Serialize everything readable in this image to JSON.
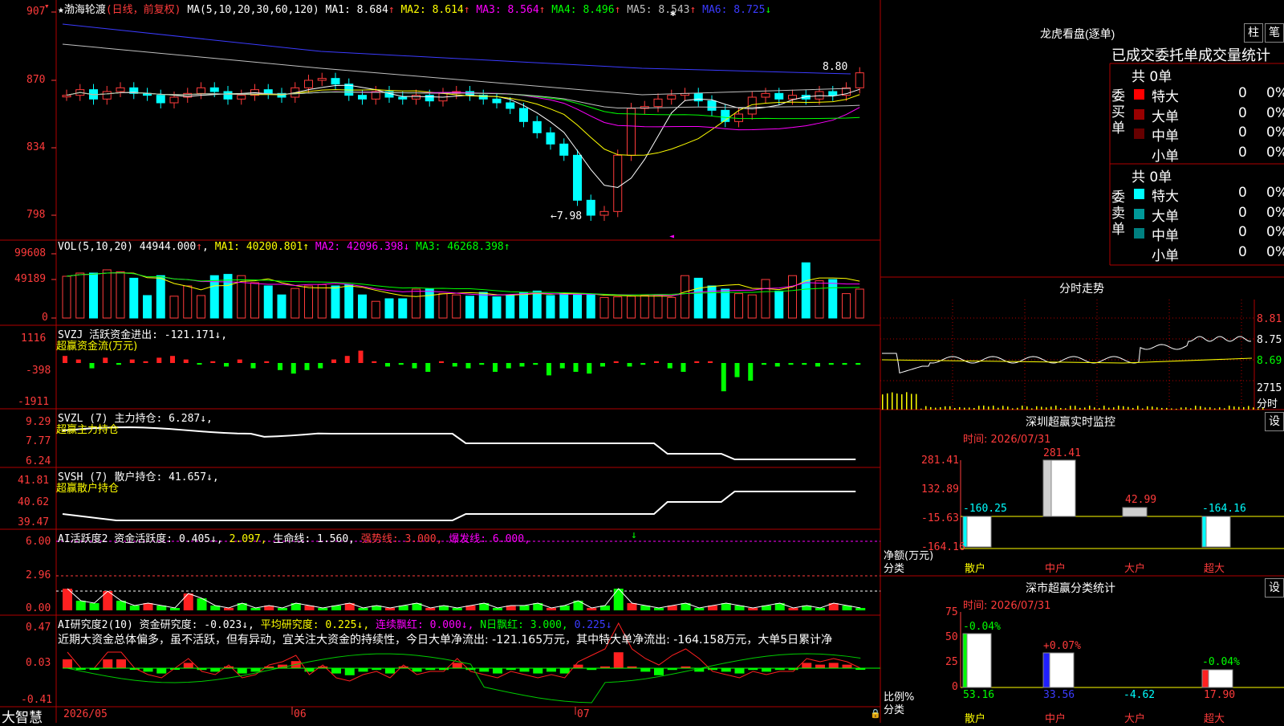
{
  "main": {
    "star": "★",
    "stock_name": "渤海轮渡",
    "mode": "(日线，前复权)",
    "ma_title": "MA(5,10,20,30,60,120)",
    "ma": [
      {
        "label": "MA1:",
        "value": "8.684",
        "arrow": "↑",
        "color": "#ffffff"
      },
      {
        "label": "MA2:",
        "value": "8.614",
        "arrow": "↑",
        "color": "#ffff00"
      },
      {
        "label": "MA3:",
        "value": "8.564",
        "arrow": "↑",
        "color": "#ff00ff"
      },
      {
        "label": "MA4:",
        "value": "8.496",
        "arrow": "↑",
        "color": "#00ff00"
      },
      {
        "label": "MA5:",
        "value": "8.543",
        "arrow": "↑",
        "color": "#c0c0c0"
      },
      {
        "label": "MA6:",
        "value": "8.725",
        "arrow": "↓",
        "color": "#3b3bff"
      }
    ],
    "y_ticks": [
      "907",
      "870",
      "834",
      "798"
    ],
    "high_label": "8.80",
    "low_label": "←7.98"
  },
  "vol": {
    "title": "VOL(5,10,20)",
    "value": "44944.000",
    "ma1": "MA1: 40200.801↑",
    "ma2": "MA2: 42096.398↓",
    "ma3": "MA3: 46268.398↑",
    "y_ticks": [
      "99608",
      "49189",
      "0"
    ]
  },
  "svzj": {
    "title": "SVZJ  活跃资金进出: -121.171↓,",
    "subtitle": "超赢资金流(万元)",
    "y_ticks": [
      "1116",
      "-398",
      "-1911"
    ]
  },
  "svzl": {
    "title": "SVZL (7) 主力持仓: 6.287↓,",
    "subtitle": "超赢主力持仓",
    "y_ticks": [
      "9.29",
      "7.77",
      "6.24"
    ]
  },
  "svsh": {
    "title": "SVSH (7) 散户持仓: 41.657↓,",
    "subtitle": "超赢散户持仓",
    "y_ticks": [
      "41.81",
      "40.62",
      "39.47"
    ]
  },
  "ai1": {
    "title": "AI活跃度2 资金活跃度: 0.405↓,",
    "v2": "2.097,",
    "life": "生命线: 1.560,",
    "strong": "强势线: 3.000,",
    "burst": "爆发线: 6.000,",
    "y_ticks": [
      "6.00",
      "2.96",
      "0.00"
    ]
  },
  "ai2": {
    "title": "AI研究度2(10) 资金研究度: -0.023↓,",
    "avg": "平均研究度: 0.225↓,",
    "cont": "连续飘红: 0.000↓,",
    "nday": "N日飘红: 3.000,",
    "last": "0.225↓",
    "text": "近期大资金总体偏多，虽不活跃，但有异动，宜关注大资金的持续性，今日大单净流出: -121.165万元，其中特大单净流出: -164.158万元，大单5日累计净",
    "y_ticks": [
      "0.47",
      "0.03",
      "-0.41"
    ]
  },
  "bottom": {
    "app": "大智慧",
    "dates": [
      "2026/05",
      "06",
      "07"
    ]
  },
  "lhb": {
    "title": "龙虎看盘(逐单)",
    "btn1": "柱",
    "btn2": "笔",
    "tabs": "已成交委托单成交量统计",
    "buy_label": "委买单",
    "sell_label": "委卖单",
    "buy_total": "共 0单",
    "sell_total": "共 0单",
    "rows": [
      "特大",
      "大单",
      "中单",
      "小单"
    ],
    "buy_colors": [
      "#ff0000",
      "#990000",
      "#660000",
      "#000000"
    ],
    "sell_colors": [
      "#00ffff",
      "#009999",
      "#008080",
      "#000000"
    ],
    "zero": "0",
    "pct": "0%"
  },
  "fenshi": {
    "title": "分时走势",
    "p1": "8.81",
    "p2": "8.75",
    "p3": "8.69",
    "vol": "2715",
    "unit": "分时"
  },
  "szmon": {
    "title": "深圳超赢实时监控",
    "btn": "设",
    "time": "时间: 2026/07/31",
    "y_ticks": [
      "281.41",
      "132.89",
      "-15.63",
      "-164.16"
    ],
    "values": [
      "-160.25",
      "281.41",
      "42.99",
      "-164.16"
    ],
    "cats": [
      "散户",
      "中户",
      "大户",
      "超大"
    ],
    "ylabel": "净额(万元)",
    "xlabel": "分类"
  },
  "szcls": {
    "title": "深市超赢分类统计",
    "btn": "设",
    "time": "时间: 2026/07/31",
    "y_ticks": [
      "75",
      "50",
      "25",
      "0"
    ],
    "pcts": [
      "-0.04%",
      "+0.07%",
      "",
      "-0.04%"
    ],
    "values": [
      "53.16",
      "33.56",
      "-4.62",
      "17.90"
    ],
    "cats": [
      "散户",
      "中户",
      "大户",
      "超大"
    ],
    "ylabel": "比例%",
    "xlabel": "分类"
  }
}
